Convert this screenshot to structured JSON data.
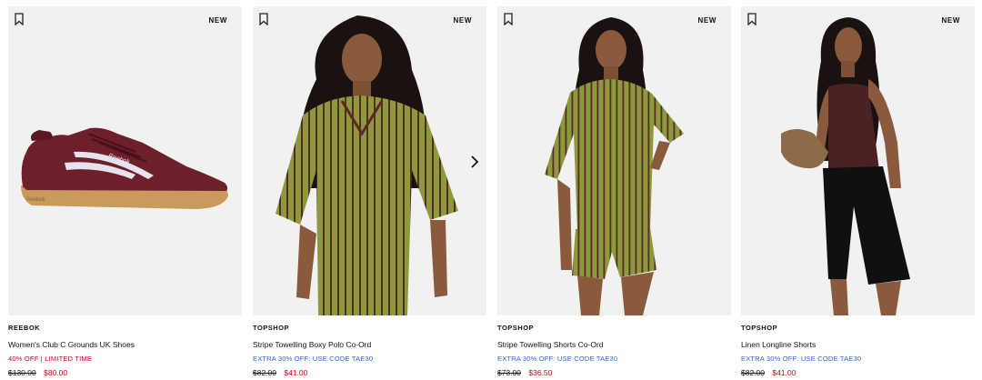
{
  "products": [
    {
      "brand": "REEBOK",
      "title": "Women's Club C Grounds UK Shoes",
      "badge": "NEW",
      "promo": "40% OFF | LIMITED TIME",
      "promo_color": "#d0021b",
      "price_was": "$130.00",
      "price_now": "$80.00",
      "image": "maroon-suede-sneaker-gum-sole"
    },
    {
      "brand": "TOPSHOP",
      "title": "Stripe Towelling Boxy Polo Co-Ord",
      "badge": "NEW",
      "promo": "EXTRA 30% OFF: USE CODE TAE30",
      "promo_color": "#2f62c8",
      "price_was": "$82.00",
      "price_now": "$41.00",
      "image": "model-green-stripe-polo"
    },
    {
      "brand": "TOPSHOP",
      "title": "Stripe Towelling Shorts Co-Ord",
      "badge": "NEW",
      "promo": "EXTRA 30% OFF: USE CODE TAE30",
      "promo_color": "#2f62c8",
      "price_was": "$73.00",
      "price_now": "$36.50",
      "image": "model-green-stripe-shorts-set"
    },
    {
      "brand": "TOPSHOP",
      "title": "Linen Longline Shorts",
      "badge": "NEW",
      "promo": "EXTRA 30% OFF: USE CODE TAE30",
      "promo_color": "#2f62c8",
      "price_was": "$82.00",
      "price_now": "$41.00",
      "image": "model-black-linen-shorts"
    }
  ],
  "icons": {
    "bookmark": "bookmark-icon",
    "next": "chevron-right-icon"
  }
}
